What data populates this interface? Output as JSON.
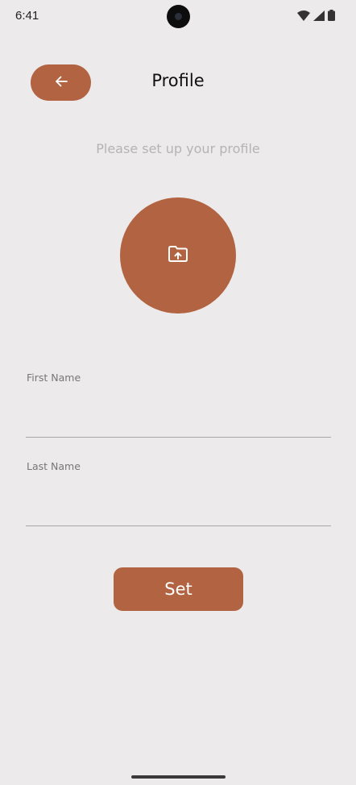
{
  "status_bar": {
    "time": "6:41",
    "icons": [
      "wifi-icon",
      "signal-icon",
      "battery-icon"
    ]
  },
  "header": {
    "back_icon": "arrow-left-icon",
    "title": "Profile"
  },
  "subtitle": "Please set up your profile",
  "avatar_upload": {
    "icon": "folder-upload-icon"
  },
  "form": {
    "first_name": {
      "label": "First Name",
      "value": ""
    },
    "last_name": {
      "label": "Last Name",
      "value": ""
    }
  },
  "submit_label": "Set",
  "colors": {
    "accent": "#B26341",
    "background": "#ECEAEA",
    "muted_text": "#B5B3B3",
    "label_text": "#777777",
    "divider": "#A8A6A6"
  }
}
